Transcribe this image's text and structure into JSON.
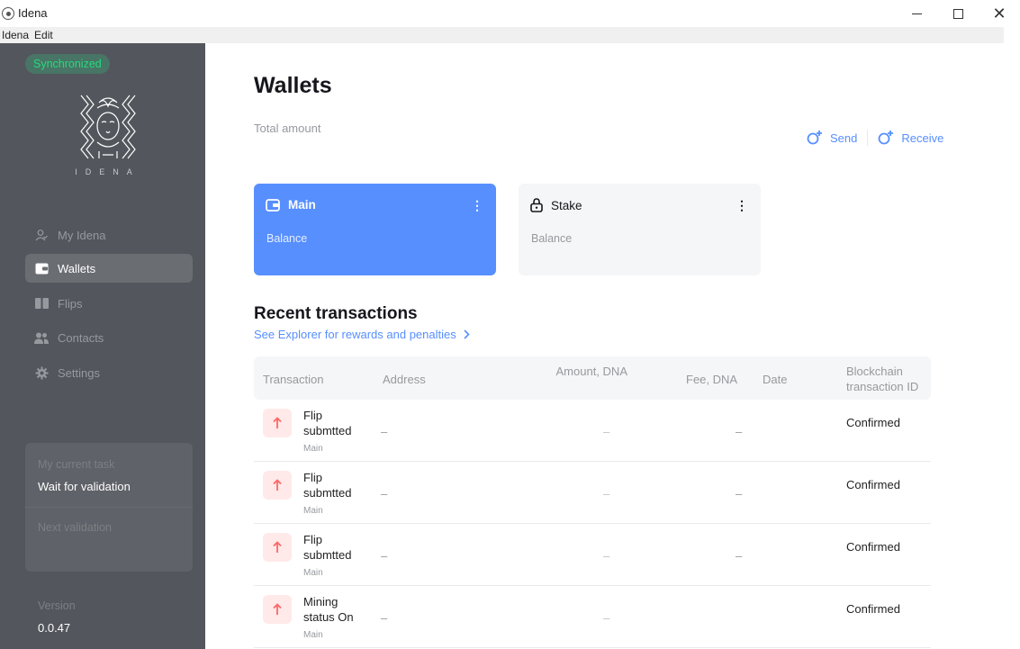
{
  "window": {
    "title": "Idena"
  },
  "menubar": {
    "items": [
      "Idena",
      "Edit"
    ]
  },
  "sidebar": {
    "sync_status": "Synchronized",
    "logo_text": "IDENA",
    "nav": [
      {
        "label": "My Idena",
        "icon": "user-icon"
      },
      {
        "label": "Wallets",
        "icon": "wallet-icon",
        "active": true
      },
      {
        "label": "Flips",
        "icon": "flips-icon"
      },
      {
        "label": "Contacts",
        "icon": "contacts-icon"
      },
      {
        "label": "Settings",
        "icon": "gear-icon"
      }
    ],
    "task": {
      "label": "My current task",
      "value": "Wait for validation",
      "next_label": "Next validation"
    },
    "version": {
      "label": "Version",
      "value": "0.0.47"
    }
  },
  "main": {
    "title": "Wallets",
    "total_label": "Total amount",
    "actions": {
      "send": "Send",
      "receive": "Receive"
    },
    "cards": [
      {
        "name": "Main",
        "balance_label": "Balance",
        "icon": "wallet-icon",
        "color": "#578fff"
      },
      {
        "name": "Stake",
        "balance_label": "Balance",
        "icon": "lock-icon",
        "color": "#f5f6f7"
      }
    ],
    "recent": {
      "title": "Recent transactions",
      "explorer_link": "See Explorer for rewards and penalties"
    },
    "table": {
      "headers": {
        "transaction": "Transaction",
        "address": "Address",
        "amount": "Amount, DNA",
        "fee": "Fee, DNA",
        "date": "Date",
        "blockchain": "Blockchain transaction ID"
      },
      "rows": [
        {
          "type": "Flip submtted",
          "wallet": "Main",
          "address": "–",
          "amount": "–",
          "fee": "–",
          "status": "Confirmed"
        },
        {
          "type": "Flip submtted",
          "wallet": "Main",
          "address": "–",
          "amount": "–",
          "fee": "–",
          "status": "Confirmed"
        },
        {
          "type": "Flip submtted",
          "wallet": "Main",
          "address": "–",
          "amount": "–",
          "fee": "–",
          "status": "Confirmed"
        },
        {
          "type": "Mining status On",
          "wallet": "Main",
          "address": "–",
          "amount": "–",
          "fee": "",
          "status": "Confirmed"
        }
      ]
    }
  }
}
